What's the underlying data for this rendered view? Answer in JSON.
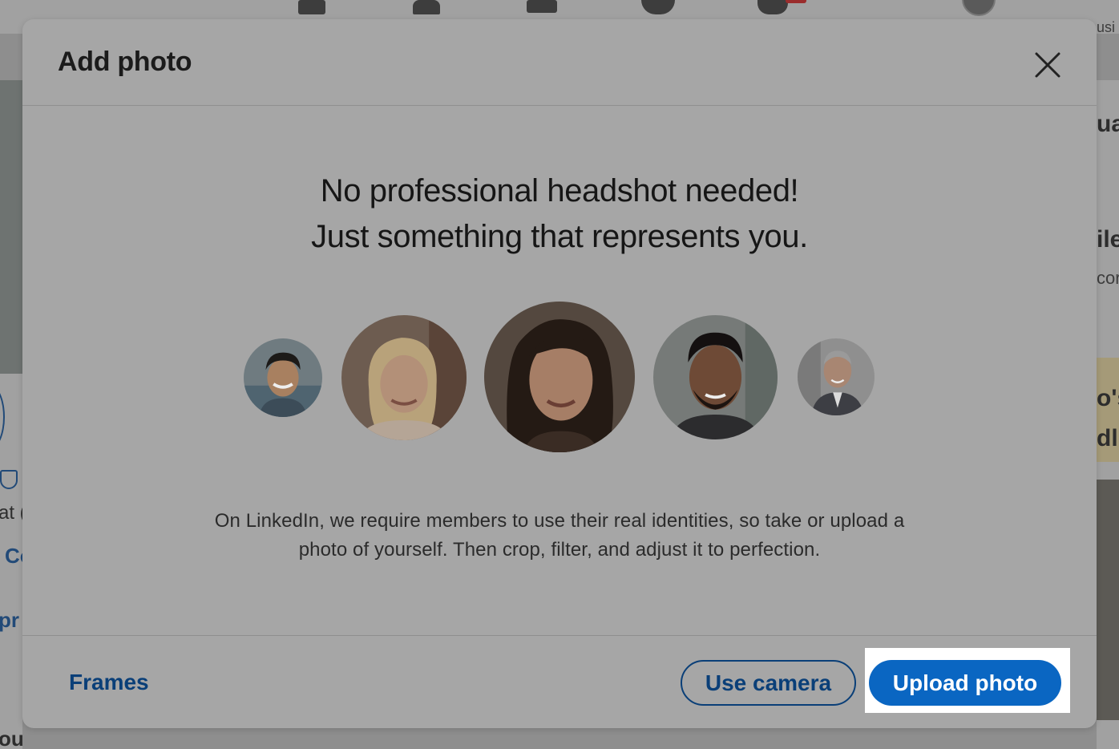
{
  "modal": {
    "title": "Add photo",
    "close_label": "Close",
    "headline_line1": "No professional headshot needed!",
    "headline_line2": "Just something that represents you.",
    "description_line1": "On LinkedIn, we require members to use their real identities, so take or upload a",
    "description_line2": "photo of yourself. Then crop, filter, and adjust it to perfection.",
    "footer": {
      "frames_label": "Frames",
      "use_camera_label": "Use camera",
      "upload_photo_label": "Upload photo"
    }
  },
  "background": {
    "right_fragment_1": "usi",
    "right_fragment_2": "ua",
    "right_fragment_3": "ile",
    "right_fragment_4": "cor",
    "right_fragment_5": "o's",
    "right_fragment_6": "dl",
    "left_fragment_1": "at (",
    "left_fragment_2": "Co",
    "left_fragment_3": "pr",
    "left_fragment_4": "ou"
  },
  "colors": {
    "primary_blue": "#0a66c2",
    "link_blue": "#0a3f78",
    "overlay_gray": "#a6a6a6"
  },
  "icons": {
    "close": "close-icon",
    "sample_avatars": [
      "avatar-man-smiling",
      "avatar-woman-blonde",
      "avatar-woman-dark-hair",
      "avatar-man-beard",
      "avatar-man-suit"
    ]
  }
}
